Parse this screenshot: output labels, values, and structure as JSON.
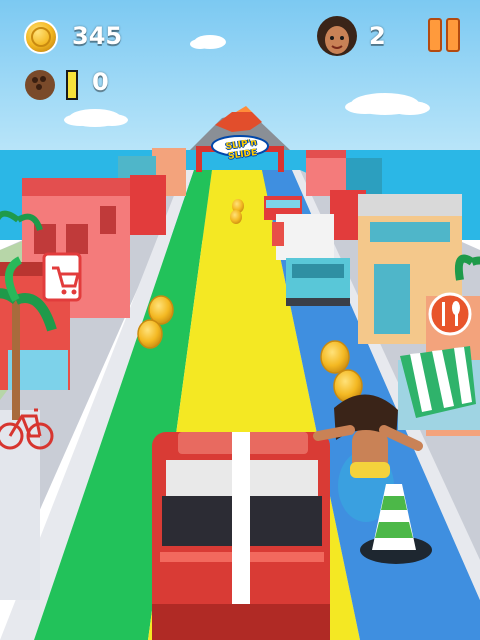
{
  "hud": {
    "coins": "345",
    "coconuts": "0",
    "lives": "2",
    "coconut_meter_fill": 0
  },
  "scene": {
    "arch_sign_text": "SLIP'n SLIDE"
  },
  "colors": {
    "sky": "#8fd3f5",
    "sea": "#2bb7e6",
    "lane_left": "#22c25a",
    "lane_middle": "#f4e823",
    "lane_right": "#3f8fe0",
    "coin": "#f4b923",
    "car": "#d93b35",
    "pause": "#ff9a3c"
  },
  "icons": {
    "coin": "coin-icon",
    "coconut": "coconut-icon",
    "player": "player-avatar-icon",
    "pause": "pause-icon"
  }
}
